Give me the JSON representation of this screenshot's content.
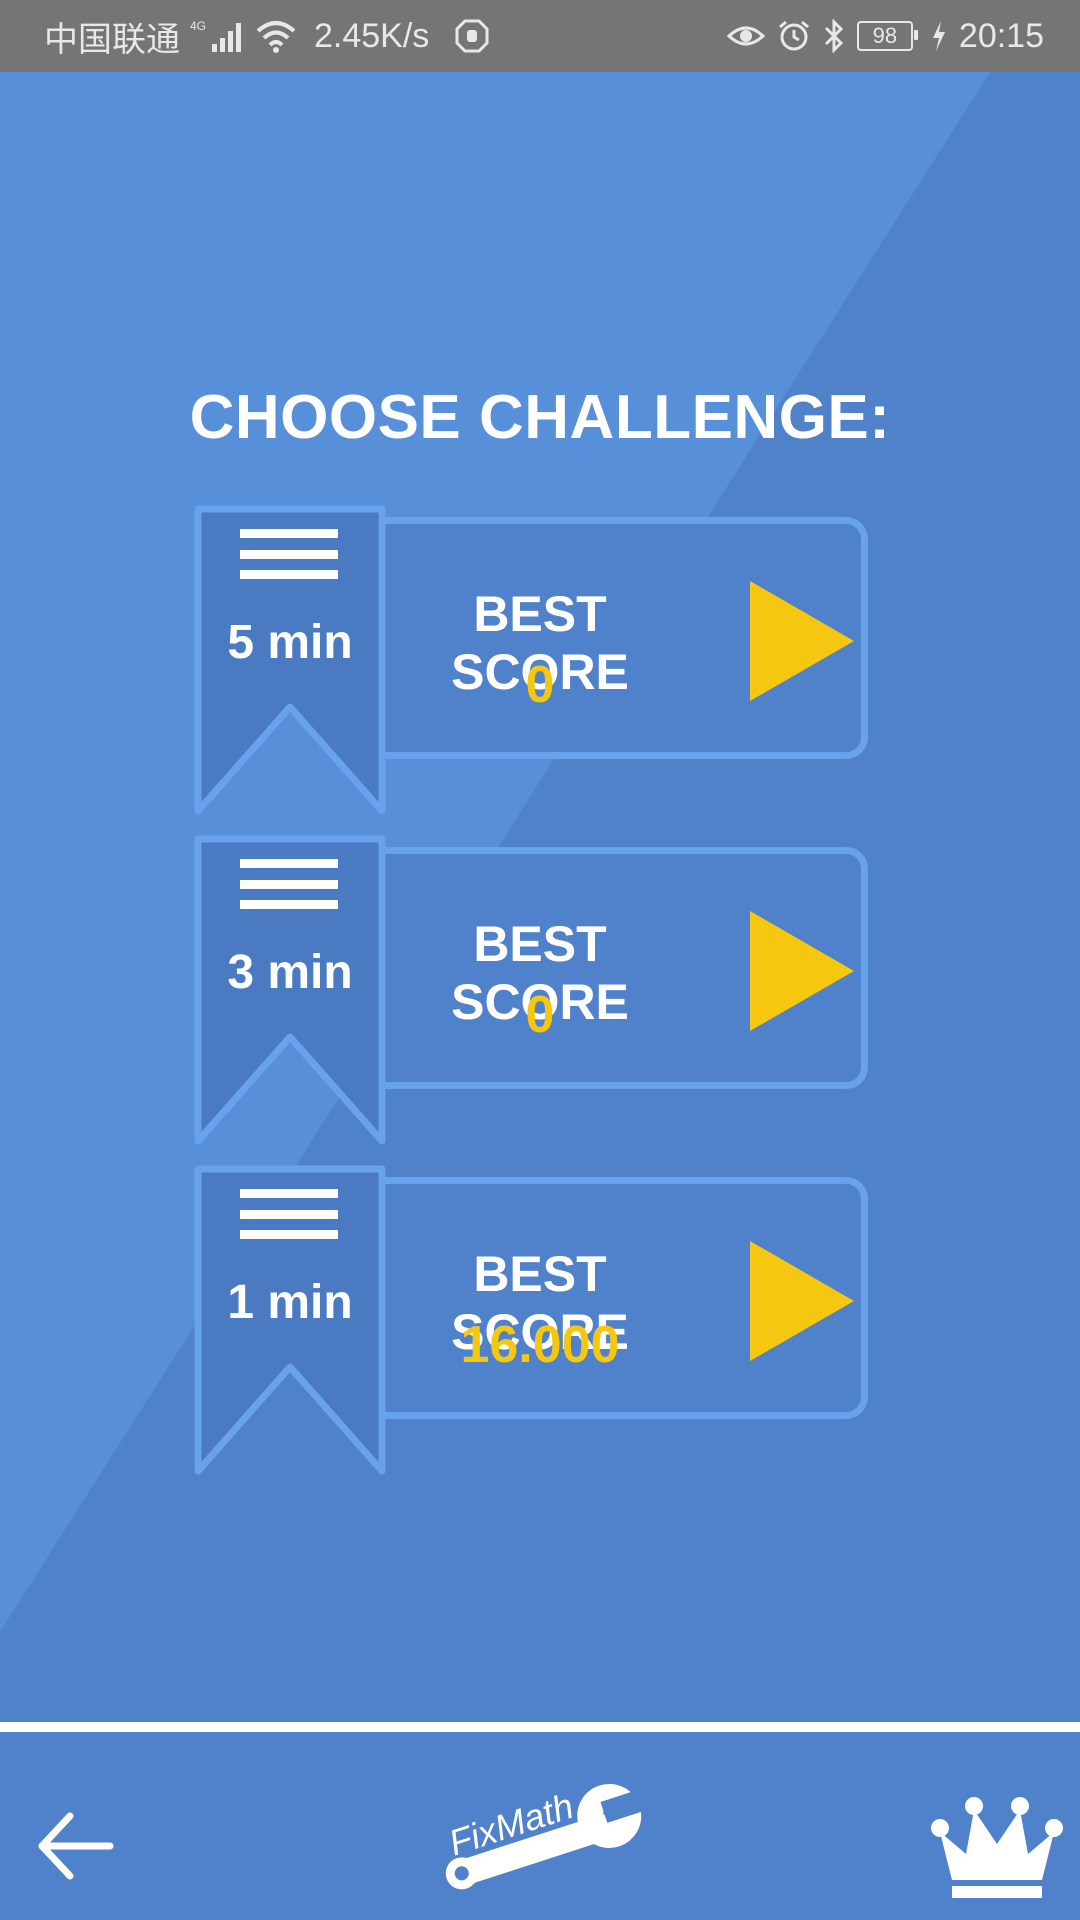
{
  "status_bar": {
    "carrier": "中国联通",
    "network_type": "4G",
    "speed": "2.45K/s",
    "battery": "98",
    "time": "20:15",
    "icons": [
      "signal-icon",
      "wifi-icon",
      "app-notification-icon",
      "eye-icon",
      "alarm-icon",
      "bluetooth-icon",
      "battery-icon",
      "charging-icon"
    ]
  },
  "title": "CHOOSE CHALLENGE:",
  "challenges": [
    {
      "duration": "5 min",
      "score_label": "BEST SCORE",
      "score": "0"
    },
    {
      "duration": "3 min",
      "score_label": "BEST SCORE",
      "score": "0"
    },
    {
      "duration": "1 min",
      "score_label": "BEST SCORE",
      "score": "16.000"
    }
  ],
  "bottom_bar": {
    "logo_text": "FixMath",
    "icons": [
      "back-arrow-icon",
      "fixmath-logo",
      "crown-icon"
    ]
  },
  "colors": {
    "background": "#5790d9",
    "card": "#4f82ca",
    "card_border": "#68a1ec",
    "ribbon": "#4a7bc2",
    "accent_yellow": "#f6c710",
    "text": "#ffffff",
    "status_bar": "#757575"
  }
}
